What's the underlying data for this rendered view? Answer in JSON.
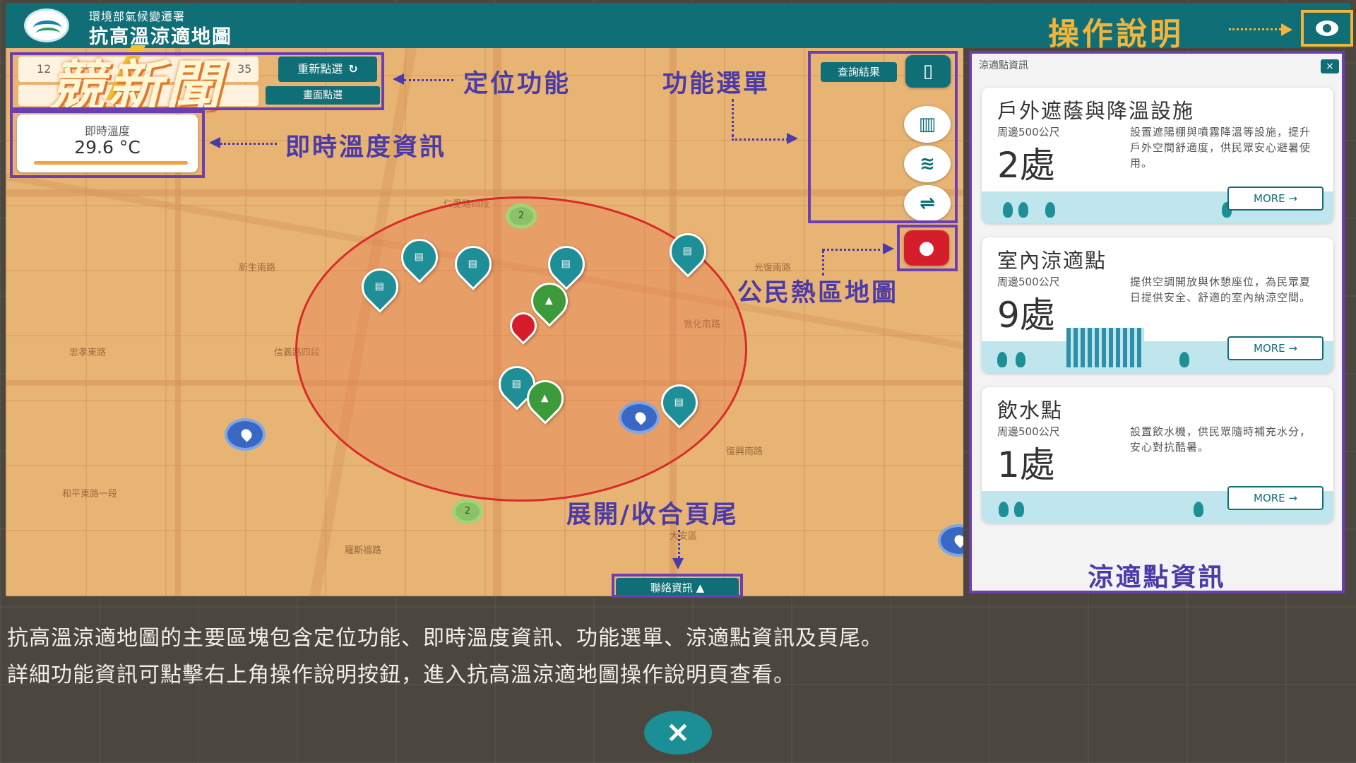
{
  "header": {
    "org_name": "環境部氣候變遷署",
    "title": "抗高溫涼適地圖",
    "help_label": "操作說明"
  },
  "watermark": "競新聞",
  "location": {
    "input_value": "12",
    "input_suffix": "35",
    "refresh_label": "重新點選",
    "center_label": "畫面點選"
  },
  "temperature": {
    "label": "即時溫度",
    "value": "29.6 °C"
  },
  "menu": {
    "query_label": "查詢結果"
  },
  "map": {
    "clusters": [
      "2",
      "2"
    ],
    "streets": [
      "仁愛路四段",
      "信義路四段",
      "和平東路一段",
      "敦化南路",
      "復興南路",
      "新生南路",
      "大安區",
      "忠孝東路",
      "光復南路",
      "羅斯福路"
    ]
  },
  "footer": {
    "toggle_label": "聯絡資訊"
  },
  "annotations": {
    "locate": "定位功能",
    "temp": "即時溫度資訊",
    "menu": "功能選單",
    "heatmap": "公民熱區地圖",
    "footer": "展開/收合頁尾"
  },
  "panel": {
    "title": "涼適點資訊",
    "close": "×",
    "caption": "涼適點資訊",
    "cards": [
      {
        "title": "戶外遮蔭與降溫設施",
        "sub": "周邊500公尺",
        "count": "2處",
        "desc": "設置遮陽棚與噴霧降溫等設施，提升戶外空間舒適度，供民眾安心避暑使用。",
        "more": "MORE →"
      },
      {
        "title": "室內涼適點",
        "sub": "周邊500公尺",
        "count": "9處",
        "desc": "提供空調開放與休憩座位，為民眾夏日提供安全、舒適的室內納涼空間。",
        "more": "MORE →"
      },
      {
        "title": "飲水點",
        "sub": "周邊500公尺",
        "count": "1處",
        "desc": "設置飲水機，供民眾隨時補充水分，安心對抗酷暑。",
        "more": "MORE →"
      }
    ]
  },
  "caption": {
    "line1": "抗高溫涼適地圖的主要區塊包含定位功能、即時溫度資訊、功能選單、涼適點資訊及頁尾。",
    "line2": "詳細功能資訊可點擊右上角操作說明按鈕，進入抗高溫涼適地圖操作說明頁查看。"
  },
  "close_button": "×",
  "colors": {
    "primary": "#0f6e76",
    "highlight": "#6b3fb0",
    "annotation": "#4b3aa8",
    "help": "#f2b43a",
    "heat_red": "#d61d2c"
  }
}
